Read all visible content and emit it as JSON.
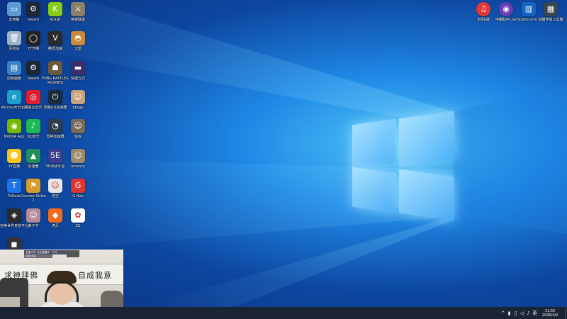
{
  "desktop": {
    "wallpaper": "windows-10-hero",
    "icons_left": [
      {
        "label": "此电脑",
        "icon": "computer-icon",
        "color": "#5b9bd5",
        "glyph": "▭"
      },
      {
        "label": "Steam",
        "icon": "steam-icon",
        "color": "#1b2838",
        "glyph": "⚙"
      },
      {
        "label": "KOOK",
        "icon": "kook-icon",
        "color": "#84cc16",
        "glyph": "K"
      },
      {
        "label": "英雄联盟",
        "icon": "lol-icon",
        "color": "#8a7f6a",
        "glyph": "⚔"
      },
      {
        "label": "回收站",
        "icon": "recycle-bin-icon",
        "color": "#9fb3c8",
        "glyph": "🗑"
      },
      {
        "label": "YY开播",
        "icon": "yy-icon",
        "color": "#222222",
        "glyph": "◯"
      },
      {
        "label": "腾讯加速",
        "icon": "accelerator-icon",
        "color": "#2a2a2a",
        "glyph": "V"
      },
      {
        "label": "汉堡",
        "icon": "burger-icon",
        "color": "#c98b3a",
        "glyph": "◓"
      },
      {
        "label": "控制面板",
        "icon": "control-panel-icon",
        "color": "#3b82c4",
        "glyph": "▤"
      },
      {
        "label": "Steam",
        "icon": "steam-icon",
        "color": "#1b2838",
        "glyph": "⚙"
      },
      {
        "label": "PUBG BATTLEGROUNDS",
        "icon": "pubg-icon",
        "color": "#6b5b3e",
        "glyph": "☗"
      },
      {
        "label": "快捷方式",
        "icon": "shortcut-icon",
        "color": "#3b2f6b",
        "glyph": "▬"
      },
      {
        "label": "Microsoft Edge",
        "icon": "edge-icon",
        "color": "#1aa0c8",
        "glyph": "e"
      },
      {
        "label": "网易云音乐",
        "icon": "netease-music-icon",
        "color": "#e01e2c",
        "glyph": "◎"
      },
      {
        "label": "网易UU加速器",
        "icon": "uu-icon",
        "color": "#1c2b3a",
        "glyph": "⏻"
      },
      {
        "label": "bbsgo",
        "icon": "avatar-icon",
        "color": "#c8a27a",
        "glyph": "☺"
      },
      {
        "label": "NVIDIA App",
        "icon": "nvidia-icon",
        "color": "#76b900",
        "glyph": "◉"
      },
      {
        "label": "QQ音乐",
        "icon": "qq-music-icon",
        "color": "#1db954",
        "glyph": "♪"
      },
      {
        "label": "雷神加速器",
        "icon": "speed-icon",
        "color": "#2d3b4f",
        "glyph": "◔"
      },
      {
        "label": "监控",
        "icon": "person-icon",
        "color": "#7a6a58",
        "glyph": "☺"
      },
      {
        "label": "YY直播",
        "icon": "yy-live-icon",
        "color": "#f5c518",
        "glyph": "☻"
      },
      {
        "label": "加速器",
        "icon": "triangle-icon",
        "color": "#1e8f5a",
        "glyph": "▲"
      },
      {
        "label": "5E对战平台",
        "icon": "5e-icon",
        "color": "#3a3f8f",
        "glyph": "5E"
      },
      {
        "label": "arcancy",
        "icon": "photo-icon",
        "color": "#9c8a6a",
        "glyph": "☺"
      },
      {
        "label": "ToDesk",
        "icon": "todesk-icon",
        "color": "#1a73e8",
        "glyph": "T"
      },
      {
        "label": "Counter-Strike 2",
        "icon": "cs2-icon",
        "color": "#d89b2b",
        "glyph": "⚑"
      },
      {
        "label": "悟空",
        "icon": "goku-icon",
        "color": "#e6e6e6",
        "glyph": "☺"
      },
      {
        "label": "G Hub",
        "icon": "ghub-icon",
        "color": "#e0342f",
        "glyph": "G"
      },
      {
        "label": "完美世界竞技平台",
        "icon": "perfect-world-icon",
        "color": "#2b2b2b",
        "glyph": "◈"
      },
      {
        "label": "黄子宇",
        "icon": "portrait-icon",
        "color": "#b88a9a",
        "glyph": "☺"
      },
      {
        "label": "虎牙",
        "icon": "huya-icon",
        "color": "#f26b1d",
        "glyph": "◆"
      },
      {
        "label": "ZQ",
        "icon": "colorful-icon",
        "color": "#ffffff",
        "glyph": "✿"
      },
      {
        "label": "",
        "icon": "dark-icon",
        "color": "#333333",
        "glyph": "◼"
      }
    ],
    "icons_right": [
      {
        "label": "全民K歌",
        "icon": "kge-icon",
        "color": "#e53935",
        "glyph": "♫"
      },
      {
        "label": "电脑助手Live",
        "icon": "live-icon",
        "color": "#6a3fb5",
        "glyph": "◉"
      },
      {
        "label": "Studio One 7",
        "icon": "studio-one-icon",
        "color": "#1565c0",
        "glyph": "▥"
      },
      {
        "label": "直播伴侣工具箱",
        "icon": "toolbox-icon",
        "color": "#37474f",
        "glyph": "▦"
      }
    ]
  },
  "webcam": {
    "overlay_line1": "主播 HZY 正在直播中 · 人气",
    "overlay_line2": "直播  弹幕",
    "banner_left": "求神拜佛",
    "banner_right": "自成我意"
  },
  "taskbar": {
    "tray_icons": [
      "chevron-up-icon",
      "network-icon",
      "volume-icon",
      "battery-icon",
      "speaker-icon"
    ],
    "ime": "英",
    "time": "11:55",
    "date": "2026/4/4"
  }
}
